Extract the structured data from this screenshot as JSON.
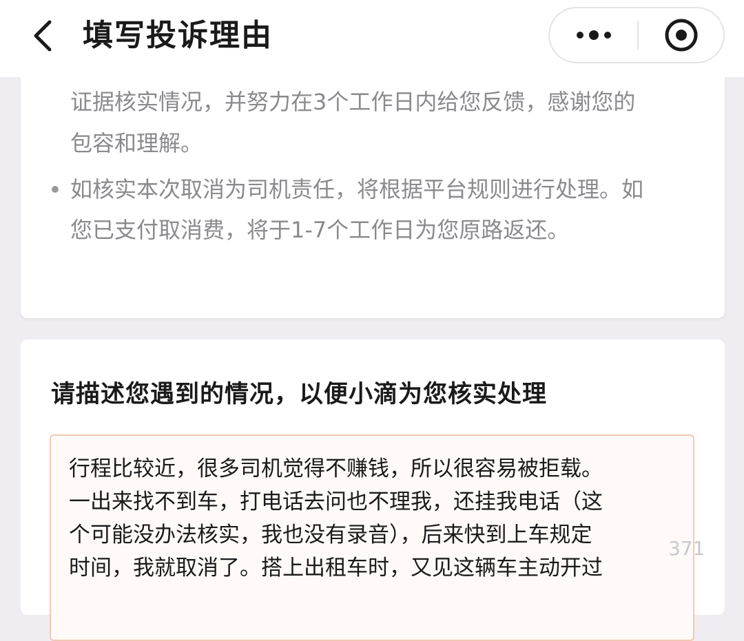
{
  "header": {
    "title": "填写投诉理由",
    "back_icon": "chevron-left-icon",
    "more_icon": "more-dots-icon",
    "close_icon": "target-close-icon"
  },
  "notice": {
    "paragraph_1_line_1": "证据核实情况，并努力在3个工作日内给您反馈，感谢您的",
    "paragraph_1_line_2": "包容和理解。",
    "paragraph_2_line_1": "如核实本次取消为司机责任，将根据平台规则进行处理。如",
    "paragraph_2_line_2": "您已支付取消费，将于1-7个工作日为您原路返还。"
  },
  "form": {
    "section_title": "请描述您遇到的情况，以便小滴为您核实处理",
    "reason_value_line_1": "行程比较近，很多司机觉得不赚钱，所以很容易被拒载。",
    "reason_value_line_2": "一出来找不到车，打电话去问也不理我，还挂我电话（这",
    "reason_value_line_3": "个可能没办法核实，我也没有录音），后来快到上车规定",
    "reason_value_line_4": "时间，我就取消了。搭上出租车时，又见这辆车主动开过",
    "char_count": "371"
  },
  "colors": {
    "background": "#efedf1",
    "border_accent": "#f0c9b3",
    "muted_text": "#8a8a8e"
  }
}
